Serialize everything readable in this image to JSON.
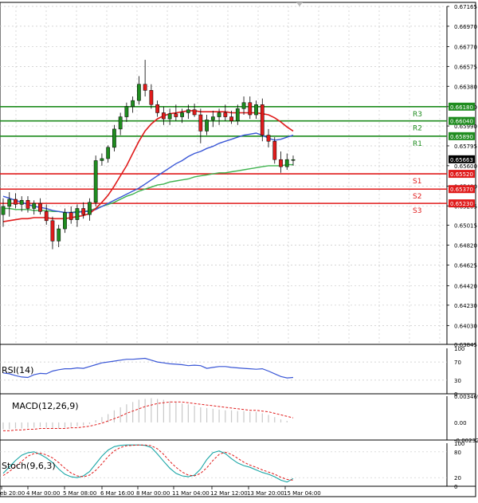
{
  "chart_data": {
    "type": "candlestick",
    "main": {
      "ylim": [
        0.63845,
        0.67165
      ],
      "y_ticks": [
        "0.67165",
        "0.66970",
        "0.66770",
        "0.66575",
        "0.66380",
        "0.66180",
        "0.65990",
        "0.65795",
        "0.65600",
        "0.65400",
        "0.65205",
        "0.65015",
        "0.64820",
        "0.64625",
        "0.64420",
        "0.64230",
        "0.64030",
        "0.63845"
      ],
      "grid": true,
      "candles": [
        {
          "o": 0.6512,
          "h": 0.6528,
          "l": 0.65,
          "c": 0.652
        },
        {
          "o": 0.652,
          "h": 0.6534,
          "l": 0.651,
          "c": 0.6527
        },
        {
          "o": 0.6527,
          "h": 0.6533,
          "l": 0.6518,
          "c": 0.6522
        },
        {
          "o": 0.6522,
          "h": 0.653,
          "l": 0.6515,
          "c": 0.6526
        },
        {
          "o": 0.6526,
          "h": 0.653,
          "l": 0.6514,
          "c": 0.6518
        },
        {
          "o": 0.6518,
          "h": 0.6526,
          "l": 0.6512,
          "c": 0.6523
        },
        {
          "o": 0.6523,
          "h": 0.6528,
          "l": 0.6512,
          "c": 0.6515
        },
        {
          "o": 0.6515,
          "h": 0.6522,
          "l": 0.6502,
          "c": 0.6506
        },
        {
          "o": 0.6506,
          "h": 0.651,
          "l": 0.6478,
          "c": 0.6486
        },
        {
          "o": 0.6486,
          "h": 0.6502,
          "l": 0.648,
          "c": 0.6498
        },
        {
          "o": 0.6498,
          "h": 0.6518,
          "l": 0.6494,
          "c": 0.6514
        },
        {
          "o": 0.6514,
          "h": 0.652,
          "l": 0.6503,
          "c": 0.6507
        },
        {
          "o": 0.6507,
          "h": 0.6522,
          "l": 0.65,
          "c": 0.6518
        },
        {
          "o": 0.6518,
          "h": 0.6524,
          "l": 0.6508,
          "c": 0.6512
        },
        {
          "o": 0.6512,
          "h": 0.6528,
          "l": 0.6506,
          "c": 0.6524
        },
        {
          "o": 0.6524,
          "h": 0.657,
          "l": 0.652,
          "c": 0.6565
        },
        {
          "o": 0.6565,
          "h": 0.6572,
          "l": 0.656,
          "c": 0.6567
        },
        {
          "o": 0.6567,
          "h": 0.658,
          "l": 0.6563,
          "c": 0.6578
        },
        {
          "o": 0.6578,
          "h": 0.66,
          "l": 0.6574,
          "c": 0.6596
        },
        {
          "o": 0.6596,
          "h": 0.6612,
          "l": 0.659,
          "c": 0.6608
        },
        {
          "o": 0.6608,
          "h": 0.6622,
          "l": 0.6603,
          "c": 0.6618
        },
        {
          "o": 0.6618,
          "h": 0.6628,
          "l": 0.6612,
          "c": 0.6624
        },
        {
          "o": 0.6624,
          "h": 0.6648,
          "l": 0.662,
          "c": 0.664
        },
        {
          "o": 0.664,
          "h": 0.6664,
          "l": 0.6628,
          "c": 0.6634
        },
        {
          "o": 0.6634,
          "h": 0.664,
          "l": 0.6616,
          "c": 0.662
        },
        {
          "o": 0.662,
          "h": 0.6624,
          "l": 0.6608,
          "c": 0.6612
        },
        {
          "o": 0.6612,
          "h": 0.6618,
          "l": 0.66,
          "c": 0.6606
        },
        {
          "o": 0.6606,
          "h": 0.6616,
          "l": 0.66,
          "c": 0.6611
        },
        {
          "o": 0.6611,
          "h": 0.662,
          "l": 0.6604,
          "c": 0.6608
        },
        {
          "o": 0.6608,
          "h": 0.6616,
          "l": 0.6602,
          "c": 0.6612
        },
        {
          "o": 0.6612,
          "h": 0.662,
          "l": 0.6606,
          "c": 0.6615
        },
        {
          "o": 0.6615,
          "h": 0.6621,
          "l": 0.6608,
          "c": 0.661
        },
        {
          "o": 0.661,
          "h": 0.6616,
          "l": 0.6582,
          "c": 0.6594
        },
        {
          "o": 0.6594,
          "h": 0.661,
          "l": 0.659,
          "c": 0.6605
        },
        {
          "o": 0.6605,
          "h": 0.6614,
          "l": 0.6598,
          "c": 0.6608
        },
        {
          "o": 0.6608,
          "h": 0.6616,
          "l": 0.66,
          "c": 0.6612
        },
        {
          "o": 0.6612,
          "h": 0.662,
          "l": 0.6604,
          "c": 0.6608
        },
        {
          "o": 0.6608,
          "h": 0.6614,
          "l": 0.6601,
          "c": 0.6604
        },
        {
          "o": 0.6604,
          "h": 0.662,
          "l": 0.66,
          "c": 0.6616
        },
        {
          "o": 0.6616,
          "h": 0.6628,
          "l": 0.661,
          "c": 0.6622
        },
        {
          "o": 0.6622,
          "h": 0.6628,
          "l": 0.6606,
          "c": 0.661
        },
        {
          "o": 0.661,
          "h": 0.6624,
          "l": 0.6606,
          "c": 0.662
        },
        {
          "o": 0.662,
          "h": 0.6626,
          "l": 0.6584,
          "c": 0.659
        },
        {
          "o": 0.659,
          "h": 0.6596,
          "l": 0.6578,
          "c": 0.6584
        },
        {
          "o": 0.6584,
          "h": 0.6588,
          "l": 0.6562,
          "c": 0.6566
        },
        {
          "o": 0.6566,
          "h": 0.6574,
          "l": 0.6553,
          "c": 0.6559
        },
        {
          "o": 0.6559,
          "h": 0.6572,
          "l": 0.6556,
          "c": 0.6566
        },
        {
          "o": 0.6566,
          "h": 0.657,
          "l": 0.656,
          "c": 0.6566
        }
      ],
      "ma_red": [
        0.6505,
        0.6506,
        0.6507,
        0.6508,
        0.6508,
        0.6509,
        0.6509,
        0.6509,
        0.6508,
        0.6508,
        0.6508,
        0.6509,
        0.651,
        0.6511,
        0.6513,
        0.6518,
        0.6524,
        0.6531,
        0.654,
        0.655,
        0.656,
        0.6572,
        0.6584,
        0.6594,
        0.6601,
        0.6606,
        0.6609,
        0.6611,
        0.6612,
        0.6613,
        0.6614,
        0.6614,
        0.6613,
        0.6613,
        0.6613,
        0.6613,
        0.6613,
        0.6612,
        0.6612,
        0.6612,
        0.6612,
        0.6612,
        0.6611,
        0.661,
        0.6607,
        0.6603,
        0.6598,
        0.6594
      ],
      "ma_blue": [
        0.653,
        0.6528,
        0.6526,
        0.6524,
        0.6522,
        0.652,
        0.6519,
        0.6518,
        0.6516,
        0.6515,
        0.6514,
        0.6514,
        0.6514,
        0.6515,
        0.6515,
        0.6517,
        0.652,
        0.6523,
        0.6526,
        0.6529,
        0.6532,
        0.6535,
        0.6538,
        0.6542,
        0.6546,
        0.655,
        0.6554,
        0.6558,
        0.6562,
        0.6565,
        0.6569,
        0.6572,
        0.6574,
        0.6577,
        0.6579,
        0.6582,
        0.6584,
        0.6586,
        0.6588,
        0.659,
        0.6591,
        0.6592,
        0.659,
        0.6587,
        0.6585,
        0.6586,
        0.6588,
        0.659
      ],
      "ma_green": [
        0.6518,
        0.6518,
        0.6517,
        0.6517,
        0.6517,
        0.6516,
        0.6516,
        0.6516,
        0.6515,
        0.6515,
        0.6514,
        0.6514,
        0.6515,
        0.6515,
        0.6516,
        0.6518,
        0.652,
        0.6522,
        0.6524,
        0.6527,
        0.653,
        0.6532,
        0.6535,
        0.6537,
        0.6539,
        0.6541,
        0.6542,
        0.6544,
        0.6545,
        0.6546,
        0.6547,
        0.6549,
        0.655,
        0.6551,
        0.6552,
        0.6553,
        0.6553,
        0.6554,
        0.6555,
        0.6556,
        0.6557,
        0.6558,
        0.6559,
        0.656,
        0.656,
        0.656,
        0.6561,
        0.6561
      ],
      "levels": [
        {
          "label": "R3",
          "value": 0.6618,
          "value_text": "0.66180",
          "color": "#1f8c1f"
        },
        {
          "label": "R2",
          "value": 0.6604,
          "value_text": "0.66040",
          "color": "#1f8c1f"
        },
        {
          "label": "R1",
          "value": 0.6589,
          "value_text": "0.65890",
          "color": "#1f8c1f"
        },
        {
          "label": "S1",
          "value": 0.6552,
          "value_text": "0.65520",
          "color": "#e01b1b"
        },
        {
          "label": "S2",
          "value": 0.6537,
          "value_text": "0.65370",
          "color": "#e01b1b"
        },
        {
          "label": "S3",
          "value": 0.6523,
          "value_text": "0.65230",
          "color": "#e01b1b"
        }
      ],
      "current_price": {
        "value": 0.65663,
        "text": "0.65663"
      }
    },
    "rsi": {
      "label": "RSI(14)",
      "ylim": [
        0,
        100
      ],
      "ticks": [
        "100",
        "70",
        "30",
        "0"
      ],
      "values": [
        46,
        44,
        40,
        37,
        36,
        42,
        45,
        44,
        50,
        53,
        55,
        55,
        57,
        56,
        60,
        64,
        68,
        70,
        72,
        74,
        76,
        76,
        77,
        78,
        74,
        70,
        68,
        66,
        65,
        64,
        62,
        63,
        62,
        56,
        58,
        60,
        60,
        58,
        57,
        56,
        55,
        54,
        55,
        50,
        44,
        38,
        35,
        36
      ]
    },
    "macd": {
      "label": "MACD(12,26,9)",
      "ylim": [
        -0.002327,
        0.003469
      ],
      "ticks": [
        "0.003469",
        "0.00",
        "-0.002327"
      ],
      "histogram": [
        -0.0009,
        -0.0009,
        -0.0008,
        -0.0008,
        -0.0007,
        -0.0007,
        -0.0006,
        -0.0007,
        -0.0008,
        -0.0008,
        -0.0007,
        -0.0006,
        -0.0005,
        -0.0004,
        -0.0002,
        0.0003,
        0.0007,
        0.0011,
        0.0016,
        0.002,
        0.0024,
        0.0027,
        0.003,
        0.0031,
        0.0032,
        0.0031,
        0.003,
        0.0028,
        0.0027,
        0.0025,
        0.0024,
        0.0022,
        0.002,
        0.0019,
        0.0018,
        0.0017,
        0.0016,
        0.0016,
        0.0015,
        0.0015,
        0.0014,
        0.0014,
        0.0012,
        0.001,
        0.0007,
        0.0004,
        0.0002,
        0.0
      ],
      "signal": [
        -0.0011,
        -0.0011,
        -0.001,
        -0.001,
        -0.0009,
        -0.0009,
        -0.0008,
        -0.0008,
        -0.0008,
        -0.0008,
        -0.0008,
        -0.0007,
        -0.0007,
        -0.0006,
        -0.0005,
        -0.0003,
        -0.0001,
        0.0002,
        0.0005,
        0.0008,
        0.0012,
        0.0015,
        0.0018,
        0.0021,
        0.0023,
        0.0025,
        0.0026,
        0.0027,
        0.0027,
        0.0027,
        0.0026,
        0.0025,
        0.0024,
        0.0023,
        0.0022,
        0.0021,
        0.002,
        0.0019,
        0.0018,
        0.0017,
        0.0016,
        0.0016,
        0.0015,
        0.0014,
        0.0012,
        0.001,
        0.0008,
        0.0006
      ]
    },
    "stoch": {
      "label": "Stoch(9,6,3)",
      "ylim": [
        0,
        100
      ],
      "ticks": [
        "100",
        "80",
        "20",
        "0"
      ],
      "k": [
        30,
        45,
        60,
        72,
        78,
        80,
        74,
        66,
        55,
        40,
        28,
        22,
        20,
        24,
        34,
        52,
        70,
        84,
        92,
        95,
        96,
        96,
        96,
        95,
        90,
        75,
        58,
        42,
        30,
        24,
        22,
        26,
        40,
        62,
        78,
        82,
        76,
        64,
        54,
        48,
        44,
        38,
        32,
        28,
        22,
        14,
        10,
        18
      ],
      "d": [
        25,
        34,
        46,
        58,
        70,
        76,
        77,
        73,
        66,
        55,
        42,
        31,
        24,
        22,
        26,
        37,
        52,
        69,
        82,
        90,
        94,
        95,
        96,
        96,
        94,
        87,
        74,
        58,
        44,
        33,
        26,
        24,
        30,
        43,
        60,
        74,
        79,
        74,
        65,
        56,
        49,
        44,
        38,
        33,
        28,
        21,
        16,
        14
      ]
    },
    "x_labels": [
      "eb 20:00",
      "4 Mar 00:00",
      "5 Mar 08:00",
      "6 Mar 16:00",
      "8 Mar 00:00",
      "11 Mar 04:00",
      "12 Mar 12:00",
      "13 Mar 20:00",
      "15 Mar 04:00"
    ]
  },
  "colors": {
    "bull": "#1f8c1f",
    "bear": "#e01b1b",
    "ma_red": "#e01b1b",
    "ma_blue": "#3a57d6",
    "ma_green": "#3fb34f",
    "grid": "#c8c8c8",
    "macd_hist": "#c8c8c8",
    "macd_signal": "#e01b1b",
    "rsi": "#3a57d6",
    "stoch_k": "#1aa6a6",
    "stoch_d": "#e01b1b"
  }
}
